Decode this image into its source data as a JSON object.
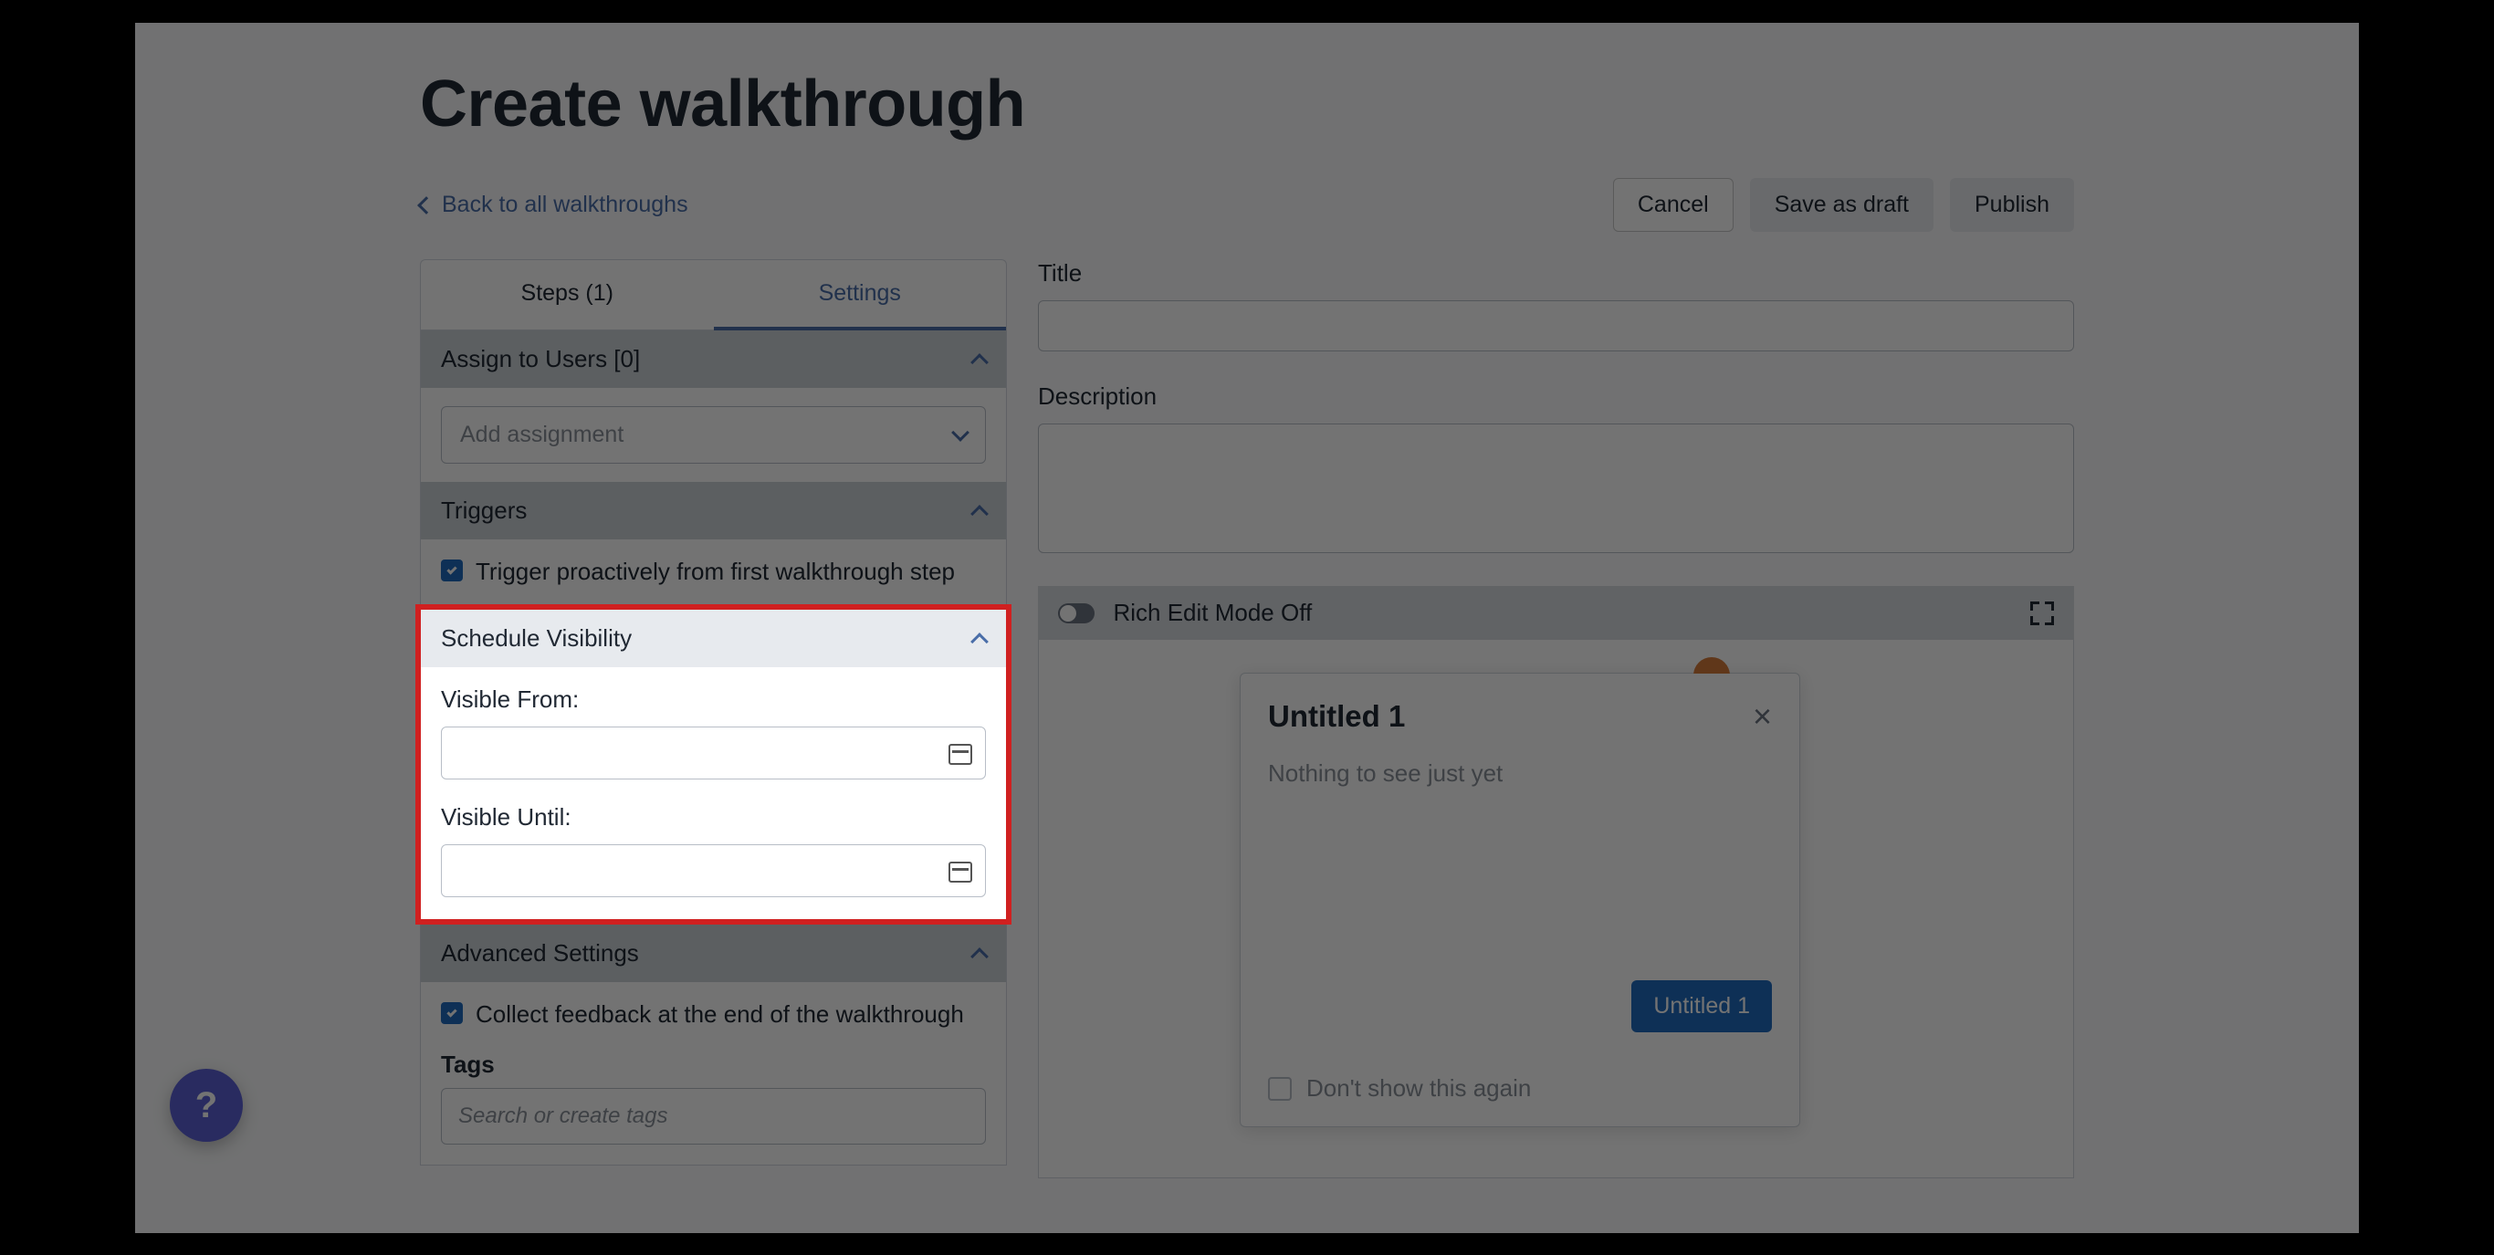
{
  "page": {
    "title": "Create walkthrough"
  },
  "backlink": {
    "label": "Back to all walkthroughs"
  },
  "actions": {
    "cancel": "Cancel",
    "save_draft": "Save as draft",
    "publish": "Publish"
  },
  "tabs": {
    "steps": "Steps (1)",
    "settings": "Settings"
  },
  "assign": {
    "header": "Assign to Users [0]",
    "placeholder": "Add assignment"
  },
  "triggers": {
    "header": "Triggers",
    "proactive": "Trigger proactively from first walkthrough step"
  },
  "schedule": {
    "header": "Schedule Visibility",
    "from_label": "Visible From:",
    "until_label": "Visible Until:"
  },
  "advanced": {
    "header": "Advanced Settings",
    "collect_feedback": "Collect feedback at the end of the walkthrough",
    "tags_label": "Tags",
    "tags_placeholder": "Search or create tags"
  },
  "form": {
    "title_label": "Title",
    "description_label": "Description"
  },
  "editor": {
    "toggle_label": "Rich Edit Mode Off"
  },
  "popover": {
    "title": "Untitled 1",
    "body": "Nothing to see just yet",
    "button": "Untitled 1",
    "dont_show": "Don't show this again"
  }
}
